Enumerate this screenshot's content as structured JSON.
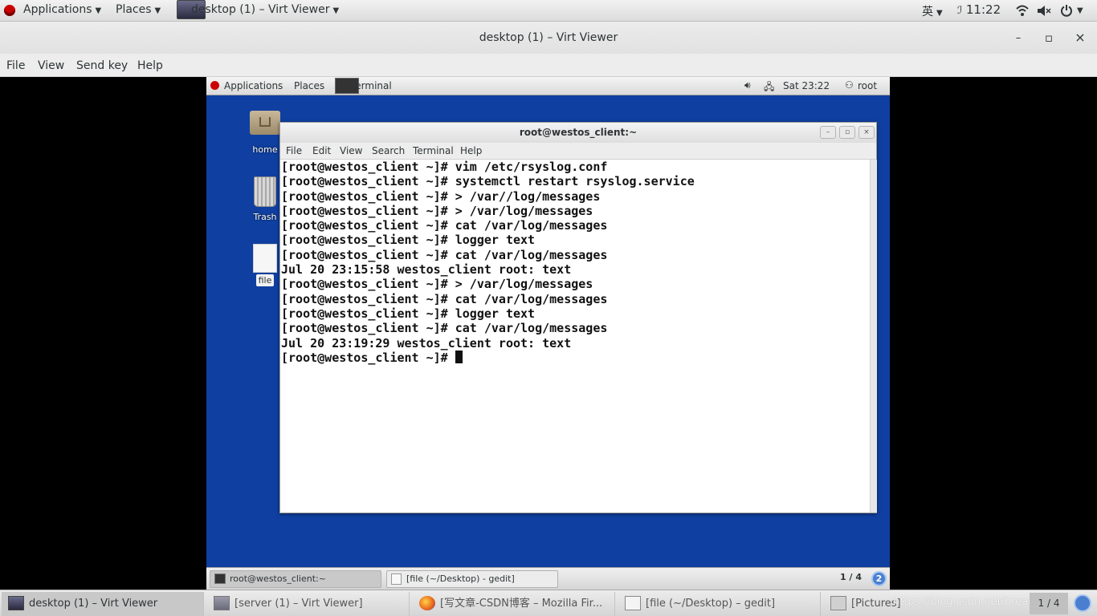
{
  "host_topbar": {
    "applications": "Applications",
    "places": "Places",
    "active_window": "desktop (1) – Virt Viewer",
    "input_method": "英",
    "time": "11:22"
  },
  "virt_viewer": {
    "title": "desktop (1) – Virt Viewer",
    "minimize": "–",
    "maximize": "▫",
    "close": "×",
    "menu": [
      "File",
      "View",
      "Send key",
      "Help"
    ]
  },
  "guest": {
    "topbar": {
      "applications": "Applications",
      "places": "Places",
      "terminal": "Terminal",
      "clock": "Sat 23:22",
      "user": "root"
    },
    "desktop_icons": [
      "home",
      "Trash",
      "file"
    ],
    "terminal": {
      "title": "root@westos_client:~",
      "menu": [
        "File",
        "Edit",
        "View",
        "Search",
        "Terminal",
        "Help"
      ],
      "lines": [
        "[root@westos_client ~]# vim /etc/rsyslog.conf",
        "[root@westos_client ~]# systemctl restart rsyslog.service",
        "[root@westos_client ~]# > /var//log/messages",
        "[root@westos_client ~]# > /var/log/messages",
        "[root@westos_client ~]# cat /var/log/messages",
        "[root@westos_client ~]# logger text",
        "[root@westos_client ~]# cat /var/log/messages",
        "Jul 20 23:15:58 westos_client root: text",
        "[root@westos_client ~]# > /var/log/messages",
        "[root@westos_client ~]# cat /var/log/messages",
        "[root@westos_client ~]# logger text",
        "[root@westos_client ~]# cat /var/log/messages",
        "Jul 20 23:19:29 westos_client root: text"
      ],
      "prompt": "[root@westos_client ~]# "
    },
    "taskbar": {
      "items": [
        "root@westos_client:~",
        "[file (~/Desktop) - gedit]"
      ],
      "workspace": "1 / 4",
      "badge": "2"
    }
  },
  "host_taskbar": {
    "items": [
      "desktop (1) – Virt Viewer",
      "[server (1) – Virt Viewer]",
      "[写文章-CSDN博客 – Mozilla Fir...",
      "[file (~/Desktop) – gedit]",
      "[Pictures]"
    ],
    "watermark": "https://blog.csdn.net/bread_n_ner",
    "workspace": "1 / 4"
  }
}
